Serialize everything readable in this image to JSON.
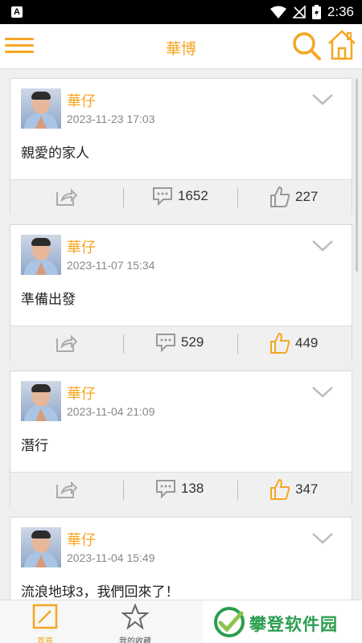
{
  "status_bar": {
    "time": "2:36",
    "app_icon": "A"
  },
  "header": {
    "title": "華博"
  },
  "posts": [
    {
      "name": "華仔",
      "date": "2023-11-23 17:03",
      "text": "親愛的家人",
      "comments": "1652",
      "likes": "227",
      "liked": false
    },
    {
      "name": "華仔",
      "date": "2023-11-07 15:34",
      "text": "準備出發",
      "comments": "529",
      "likes": "449",
      "liked": true
    },
    {
      "name": "華仔",
      "date": "2023-11-04 21:09",
      "text": "潛行",
      "comments": "138",
      "likes": "347",
      "liked": true
    },
    {
      "name": "華仔",
      "date": "2023-11-04 15:49",
      "text": "流浪地球3，我們回來了！",
      "comments": "",
      "likes": "",
      "liked": false
    }
  ],
  "bottom_nav": [
    {
      "label": "首頁",
      "icon": "edit-icon",
      "active": true
    },
    {
      "label": "我的收藏",
      "icon": "star-icon",
      "active": false
    }
  ],
  "watermark": {
    "text": "攀登软件园"
  },
  "colors": {
    "accent": "#f5a623",
    "gray_icon": "#999999",
    "watermark_green": "#2a9d4f"
  }
}
